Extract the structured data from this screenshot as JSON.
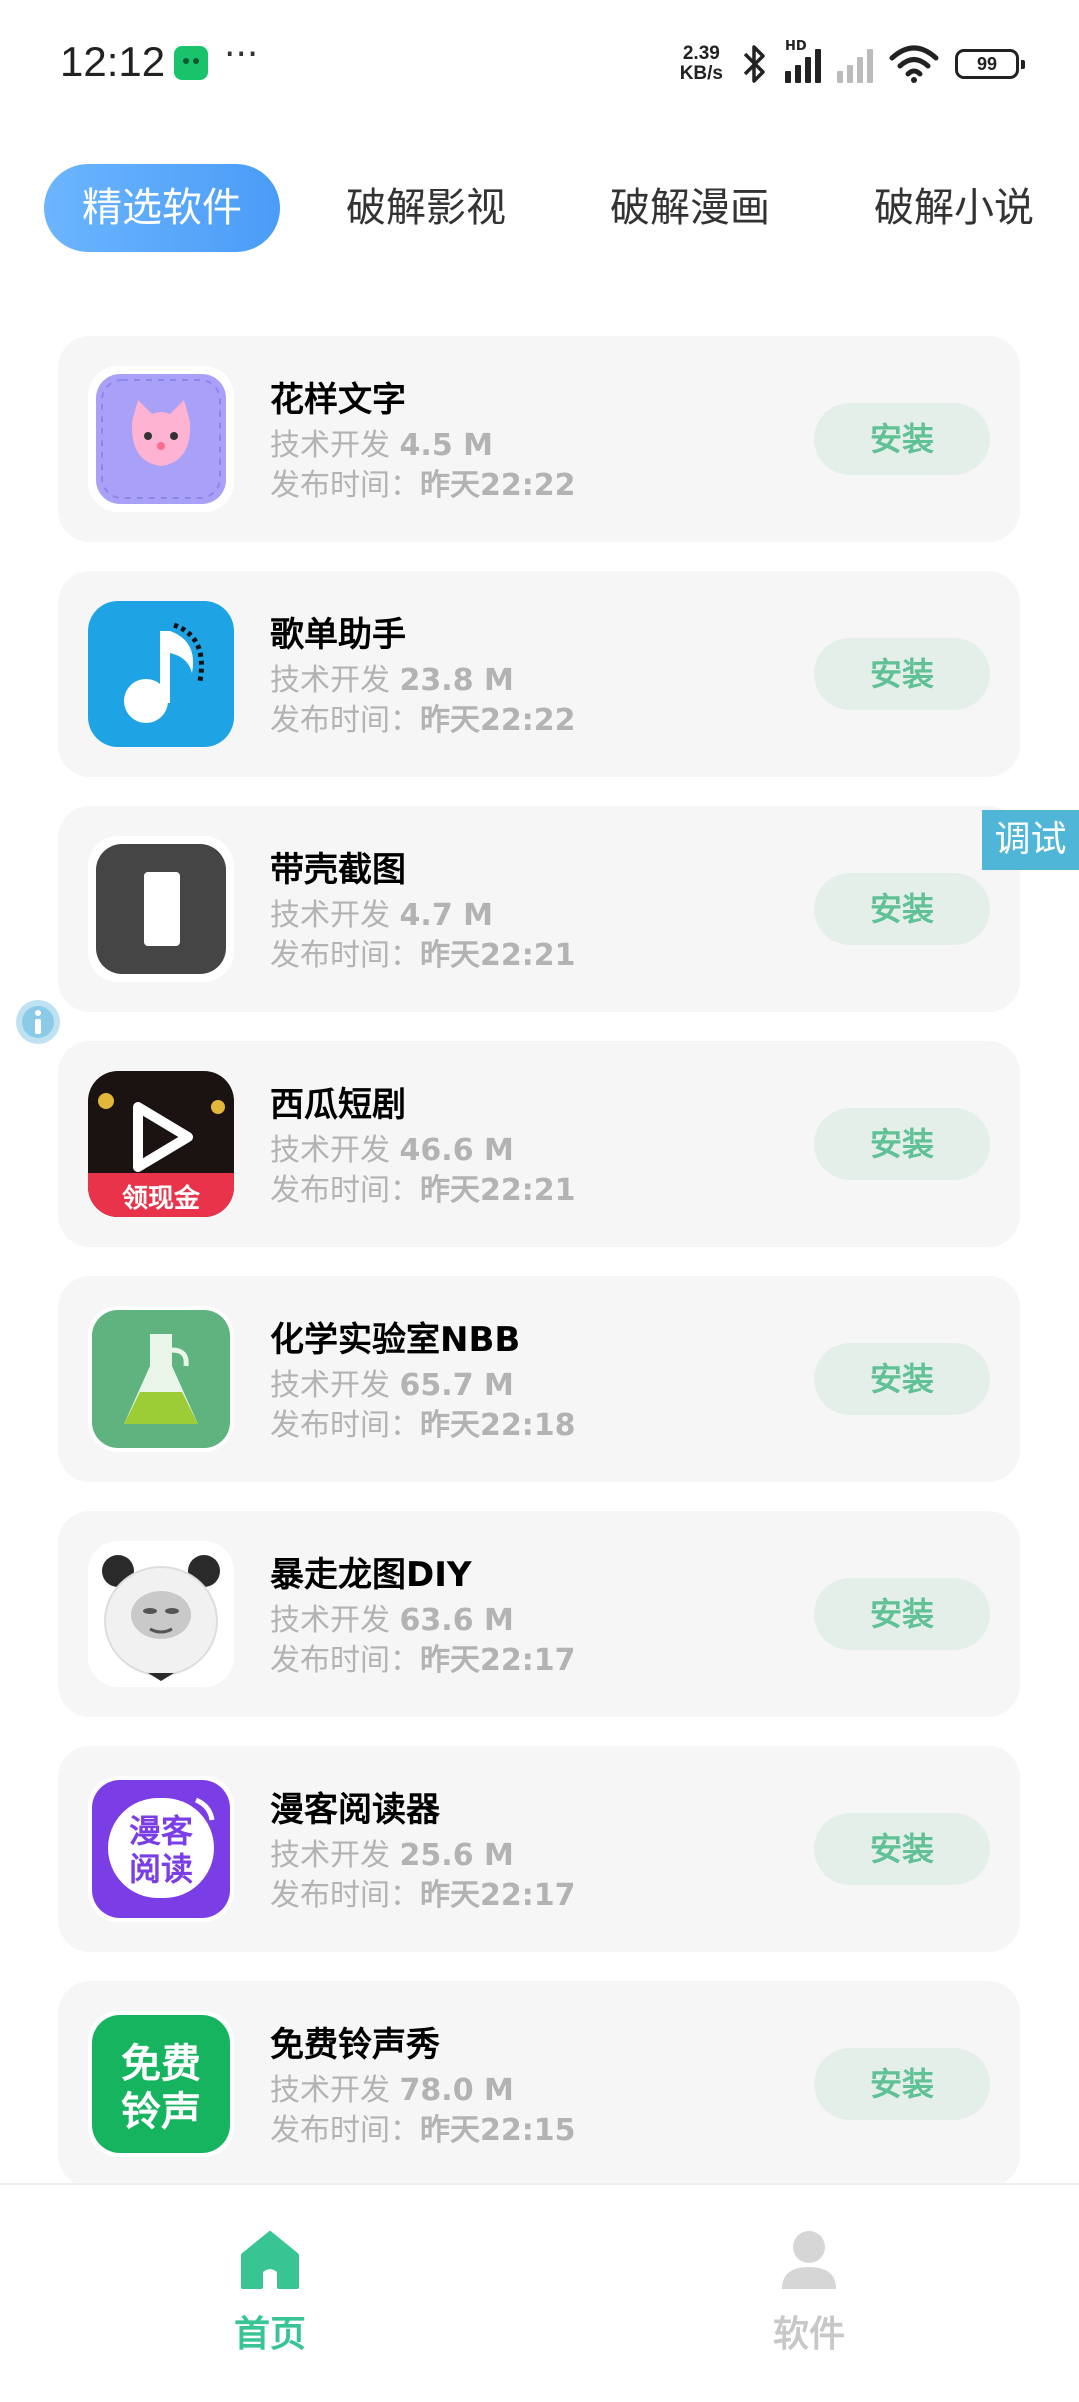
{
  "status_bar": {
    "time": "12:12",
    "speed_value": "2.39",
    "speed_unit": "KB/s",
    "hd_label": "HD",
    "battery": "99"
  },
  "tabs": [
    {
      "label": "精选软件",
      "active": true
    },
    {
      "label": "破解影视",
      "active": false
    },
    {
      "label": "破解漫画",
      "active": false
    },
    {
      "label": "破解小说",
      "active": false
    }
  ],
  "apps": [
    {
      "name": "花样文字",
      "developer": "技术开发",
      "size": "4.5 M",
      "time_label": "发布时间：",
      "time": "昨天22:22",
      "install_label": "安装",
      "icon": "pink-cat-icon"
    },
    {
      "name": "歌单助手",
      "developer": "技术开发",
      "size": "23.8 M",
      "time_label": "发布时间：",
      "time": "昨天22:22",
      "install_label": "安装",
      "icon": "music-note-icon"
    },
    {
      "name": "带壳截图",
      "developer": "技术开发",
      "size": "4.7 M",
      "time_label": "发布时间：",
      "time": "昨天22:21",
      "install_label": "安装",
      "icon": "phone-frame-icon"
    },
    {
      "name": "西瓜短剧",
      "developer": "技术开发",
      "size": "46.6 M",
      "time_label": "发布时间：",
      "time": "昨天22:21",
      "install_label": "安装",
      "icon": "play-cash-icon",
      "icon_text": "领现金"
    },
    {
      "name": "化学实验室NBB",
      "developer": "技术开发",
      "size": "65.7 M",
      "time_label": "发布时间：",
      "time": "昨天22:18",
      "install_label": "安装",
      "icon": "flask-icon"
    },
    {
      "name": "暴走龙图DIY",
      "developer": "技术开发",
      "size": "63.6 M",
      "time_label": "发布时间：",
      "time": "昨天22:17",
      "install_label": "安装",
      "icon": "panda-meme-icon"
    },
    {
      "name": "漫客阅读器",
      "developer": "技术开发",
      "size": "25.6 M",
      "time_label": "发布时间：",
      "time": "昨天22:17",
      "install_label": "安装",
      "icon": "manke-reader-icon",
      "icon_text_1": "漫客",
      "icon_text_2": "阅读"
    },
    {
      "name": "免费铃声秀",
      "developer": "技术开发",
      "size": "78.0 M",
      "time_label": "发布时间：",
      "time": "昨天22:15",
      "install_label": "安装",
      "icon": "free-ringtone-icon",
      "icon_text_1": "免费",
      "icon_text_2": "铃声"
    }
  ],
  "debug_label": "调试",
  "bottom_nav": [
    {
      "label": "首页",
      "active": true,
      "icon": "home-icon"
    },
    {
      "label": "软件",
      "active": false,
      "icon": "user-icon"
    }
  ],
  "colors": {
    "accent_blue": "#4a9cf7",
    "install_text": "#5fc195",
    "install_bg": "#e5efea",
    "nav_active": "#39c493",
    "debug_tag": "#4fb6d8"
  }
}
